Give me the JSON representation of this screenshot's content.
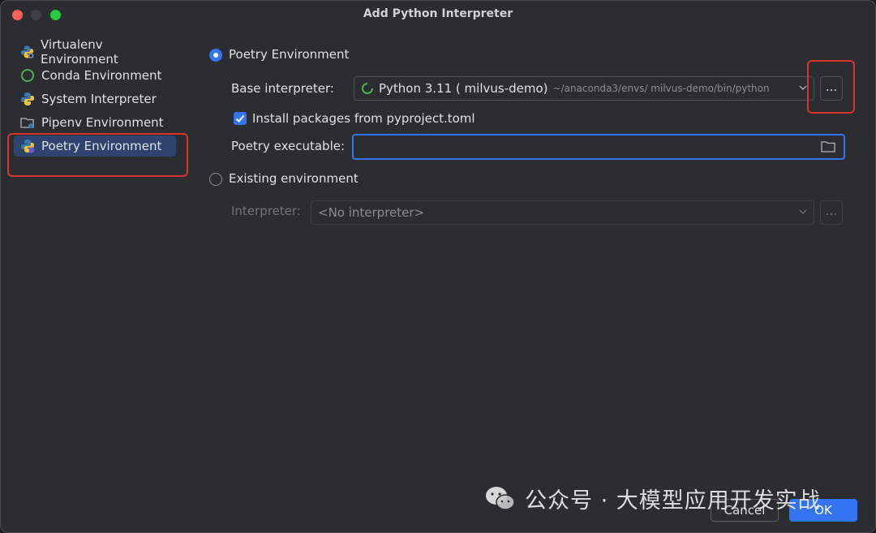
{
  "window": {
    "title": "Add Python Interpreter",
    "accent_color": "#3574f0",
    "highlight_color": "#d9342b"
  },
  "sidebar": {
    "items": [
      {
        "label": "Virtualenv Environment",
        "icon": "python-venv-icon"
      },
      {
        "label": "Conda Environment",
        "icon": "conda-icon"
      },
      {
        "label": "System Interpreter",
        "icon": "python-icon"
      },
      {
        "label": "Pipenv Environment",
        "icon": "pipenv-folder-icon"
      },
      {
        "label": "Poetry Environment",
        "icon": "poetry-icon",
        "selected": true
      }
    ]
  },
  "poetry": {
    "radio_label": "Poetry Environment",
    "base_interpreter_label": "Base interpreter:",
    "base_interpreter_value": "Python 3.11 ( milvus-demo)",
    "base_interpreter_path": "~/anaconda3/envs/ milvus-demo/bin/python",
    "browse_label": "...",
    "install_packages_label": "Install packages from pyproject.toml",
    "install_packages_checked": true,
    "poetry_executable_label": "Poetry executable:",
    "poetry_executable_value": ""
  },
  "existing": {
    "radio_label": "Existing environment",
    "interpreter_label": "Interpreter:",
    "interpreter_value": "<No interpreter>",
    "browse_label": "..."
  },
  "footer": {
    "cancel_label": "Cancel",
    "ok_label": "OK"
  },
  "watermark": {
    "text": "公众号 · 大模型应用开发实战"
  }
}
